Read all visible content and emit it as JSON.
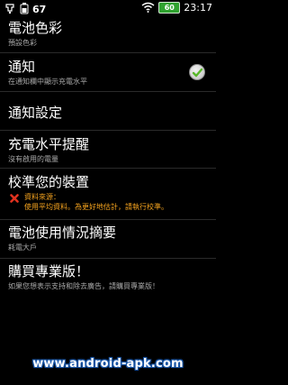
{
  "status_bar": {
    "notification_badge": "67",
    "battery_percent": "60",
    "time": "23:17",
    "icons": [
      "usb-debug-icon",
      "battery-app-icon",
      "wifi-icon",
      "battery-icon"
    ]
  },
  "settings": {
    "battery_color": {
      "title": "電池色彩",
      "summary": "預設色彩"
    },
    "notification": {
      "title": "通知",
      "summary": "在通知欄中顯示充電水平",
      "checked": true
    },
    "notification_settings": {
      "title": "通知設定"
    },
    "charge_alert": {
      "title": "充電水平提醒",
      "summary": "沒有啟用的電量"
    },
    "calibrate": {
      "title": "校準您的裝置",
      "warning_line1": "資料來源：",
      "warning_line2": "使用平均資料。為更好地估計，請執行校準。"
    },
    "battery_usage": {
      "title": "電池使用情況摘要",
      "summary": "耗電大戶"
    },
    "buy_pro": {
      "title": "購買專業版！",
      "summary": "如果您想表示支持和除去廣告，請購買專業版！"
    }
  },
  "footer": {
    "watermark": "www.android-apk.com"
  },
  "colors": {
    "warning": "#f3a21e",
    "summary_gray": "#a8a8a8",
    "battery_green": "#2fa22f",
    "watermark_blue": "#1a57a8"
  }
}
